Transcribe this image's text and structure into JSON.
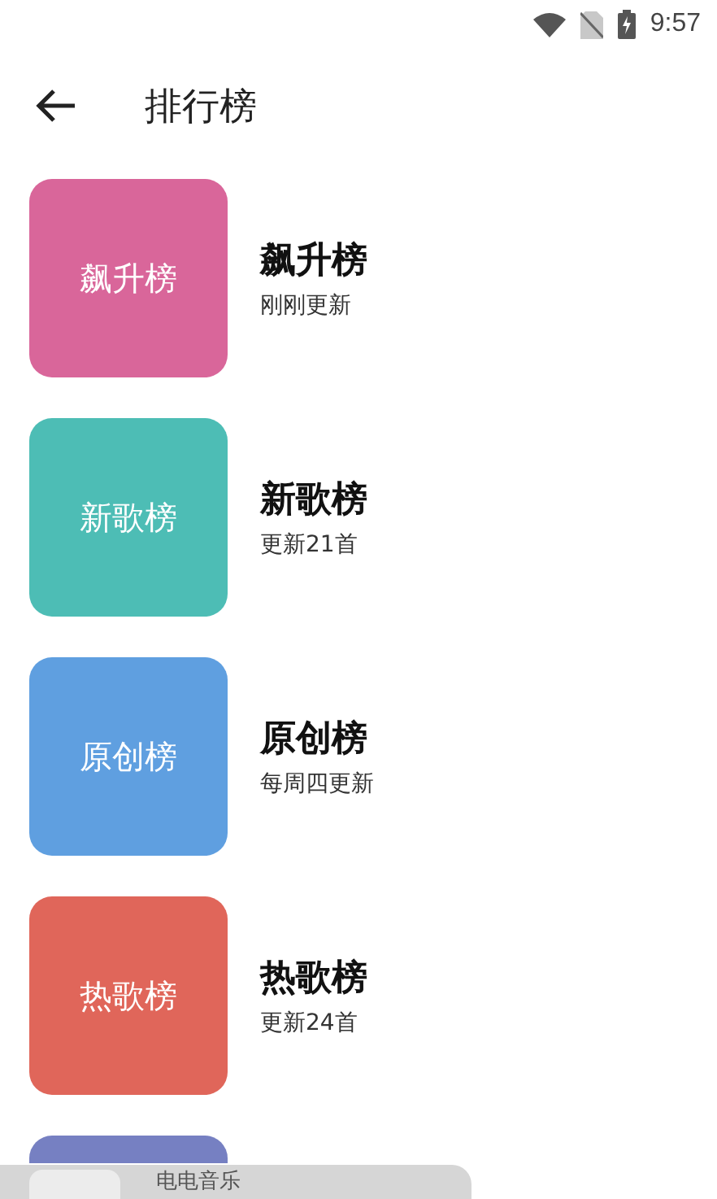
{
  "status_bar": {
    "time": "9:57"
  },
  "header": {
    "title": "排行榜"
  },
  "charts": [
    {
      "tile_label": "飙升榜",
      "title": "飙升榜",
      "subtitle": "刚刚更新",
      "color": "#d9669a"
    },
    {
      "tile_label": "新歌榜",
      "title": "新歌榜",
      "subtitle": "更新21首",
      "color": "#4dbdb5"
    },
    {
      "tile_label": "原创榜",
      "title": "原创榜",
      "subtitle": "每周四更新",
      "color": "#5f9fe0"
    },
    {
      "tile_label": "热歌榜",
      "title": "热歌榜",
      "subtitle": "更新24首",
      "color": "#e0665a"
    },
    {
      "color": "#7680c2"
    }
  ],
  "mini_player": {
    "title": "电电音乐"
  }
}
